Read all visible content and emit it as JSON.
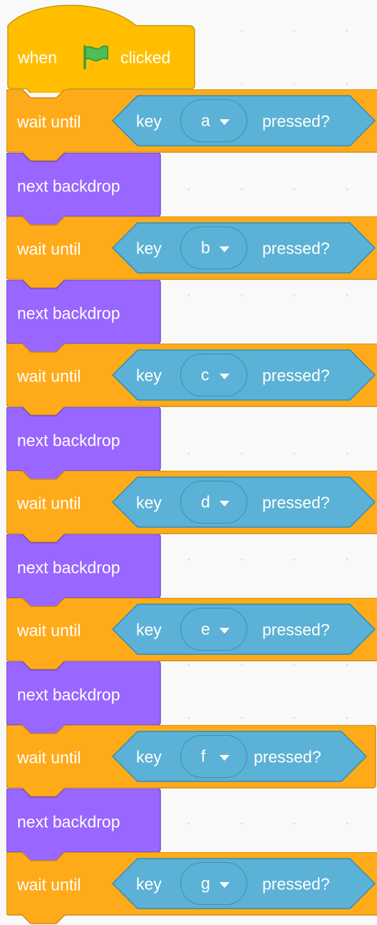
{
  "hat": {
    "label_when": "when",
    "flag_icon": "green-flag-icon",
    "label_clicked": "clicked"
  },
  "blocks": [
    {
      "type": "wait",
      "label": "wait until",
      "key_label": "key",
      "key": "a",
      "pressed_label": "pressed?"
    },
    {
      "type": "backdrop",
      "label": "next backdrop"
    },
    {
      "type": "wait",
      "label": "wait until",
      "key_label": "key",
      "key": "b",
      "pressed_label": "pressed?"
    },
    {
      "type": "backdrop",
      "label": "next backdrop"
    },
    {
      "type": "wait",
      "label": "wait until",
      "key_label": "key",
      "key": "c",
      "pressed_label": "pressed?"
    },
    {
      "type": "backdrop",
      "label": "next backdrop"
    },
    {
      "type": "wait",
      "label": "wait until",
      "key_label": "key",
      "key": "d",
      "pressed_label": "pressed?"
    },
    {
      "type": "backdrop",
      "label": "next backdrop"
    },
    {
      "type": "wait",
      "label": "wait until",
      "key_label": "key",
      "key": "e",
      "pressed_label": "pressed?"
    },
    {
      "type": "backdrop",
      "label": "next backdrop"
    },
    {
      "type": "wait",
      "label": "wait until",
      "key_label": "key",
      "key": "f",
      "pressed_label": "pressed?"
    },
    {
      "type": "backdrop",
      "label": "next backdrop"
    },
    {
      "type": "wait",
      "label": "wait until",
      "key_label": "key",
      "key": "g",
      "pressed_label": "pressed?"
    }
  ],
  "colors": {
    "events": "#ffbf00",
    "events_border": "#cc9900",
    "control": "#ffab19",
    "control_border": "#cf8b17",
    "looks": "#9966ff",
    "looks_border": "#774dcb",
    "sensing": "#5cb1d6",
    "sensing_border": "#2e8eb8",
    "sensing_field": "#4ba0c5",
    "flag": "#4cbf56",
    "flag_border": "#45993d",
    "text": "#ffffff"
  }
}
